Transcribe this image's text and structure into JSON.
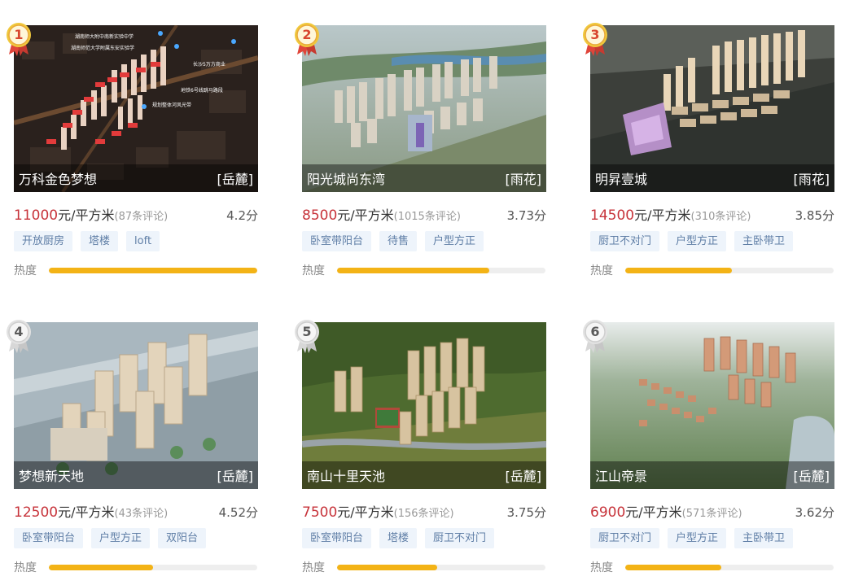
{
  "cards": [
    {
      "rank": "1",
      "name": "万科金色梦想",
      "district": "[岳麓]",
      "price": "11000",
      "unit": "元/平方米",
      "reviews": "(87条评论)",
      "score": "4.2分",
      "tags": [
        "开放厨房",
        "塔楼",
        "loft"
      ],
      "heat_label": "热度",
      "heat": 1.0,
      "photo_labels": [
        "湖南师大附中南新实验中学",
        "湖南师范大学附属东安实验学",
        "地铁6号线跳马路段",
        "长沙5万方商业",
        "规划整体河风光带"
      ]
    },
    {
      "rank": "2",
      "name": "阳光城尚东湾",
      "district": "[雨花]",
      "price": "8500",
      "unit": "元/平方米",
      "reviews": "(1015条评论)",
      "score": "3.73分",
      "tags": [
        "卧室带阳台",
        "待售",
        "户型方正"
      ],
      "heat_label": "热度",
      "heat": 0.73
    },
    {
      "rank": "3",
      "name": "明昇壹城",
      "district": "[雨花]",
      "price": "14500",
      "unit": "元/平方米",
      "reviews": "(310条评论)",
      "score": "3.85分",
      "tags": [
        "厨卫不对门",
        "户型方正",
        "主卧带卫"
      ],
      "heat_label": "热度",
      "heat": 0.51
    },
    {
      "rank": "4",
      "name": "梦想新天地",
      "district": "[岳麓]",
      "price": "12500",
      "unit": "元/平方米",
      "reviews": "(43条评论)",
      "score": "4.52分",
      "tags": [
        "卧室带阳台",
        "户型方正",
        "双阳台"
      ],
      "heat_label": "热度",
      "heat": 0.5
    },
    {
      "rank": "5",
      "name": "南山十里天池",
      "district": "[岳麓]",
      "price": "7500",
      "unit": "元/平方米",
      "reviews": "(156条评论)",
      "score": "3.75分",
      "tags": [
        "卧室带阳台",
        "塔楼",
        "厨卫不对门"
      ],
      "heat_label": "热度",
      "heat": 0.48
    },
    {
      "rank": "6",
      "name": "江山帝景",
      "district": "[岳麓]",
      "price": "6900",
      "unit": "元/平方米",
      "reviews": "(571条评论)",
      "score": "3.62分",
      "tags": [
        "厨卫不对门",
        "户型方正",
        "主卧带卫"
      ],
      "heat_label": "热度",
      "heat": 0.46
    }
  ],
  "colors": {
    "price": "#c7333a",
    "heat_fill": "#f3b316",
    "tag_bg": "#eef4fb",
    "tag_text": "#5f7ea6",
    "medal_gold": "#f0c83c",
    "medal_red": "#e0453a"
  }
}
